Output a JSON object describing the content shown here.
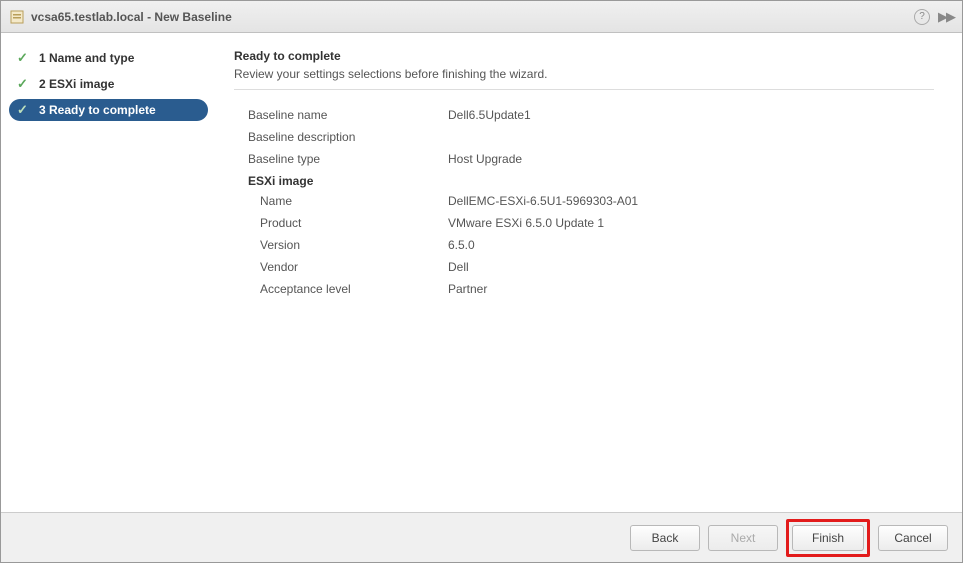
{
  "window": {
    "title": "vcsa65.testlab.local - New Baseline"
  },
  "steps": [
    {
      "label": "1  Name and type",
      "active": false
    },
    {
      "label": "2  ESXi image",
      "active": false
    },
    {
      "label": "3  Ready to complete",
      "active": true
    }
  ],
  "content": {
    "title": "Ready to complete",
    "subtitle": "Review your settings selections before finishing the wizard.",
    "fields_top": [
      {
        "label": "Baseline name",
        "value": "Dell6.5Update1"
      },
      {
        "label": "Baseline description",
        "value": ""
      },
      {
        "label": "Baseline type",
        "value": "Host Upgrade"
      }
    ],
    "section_header": "ESXi image",
    "fields_image": [
      {
        "label": "Name",
        "value": "DellEMC-ESXi-6.5U1-5969303-A01"
      },
      {
        "label": "Product",
        "value": "VMware ESXi 6.5.0 Update 1"
      },
      {
        "label": "Version",
        "value": "6.5.0"
      },
      {
        "label": "Vendor",
        "value": "Dell"
      },
      {
        "label": "Acceptance level",
        "value": "Partner"
      }
    ]
  },
  "buttons": {
    "back": "Back",
    "next": "Next",
    "finish": "Finish",
    "cancel": "Cancel"
  }
}
